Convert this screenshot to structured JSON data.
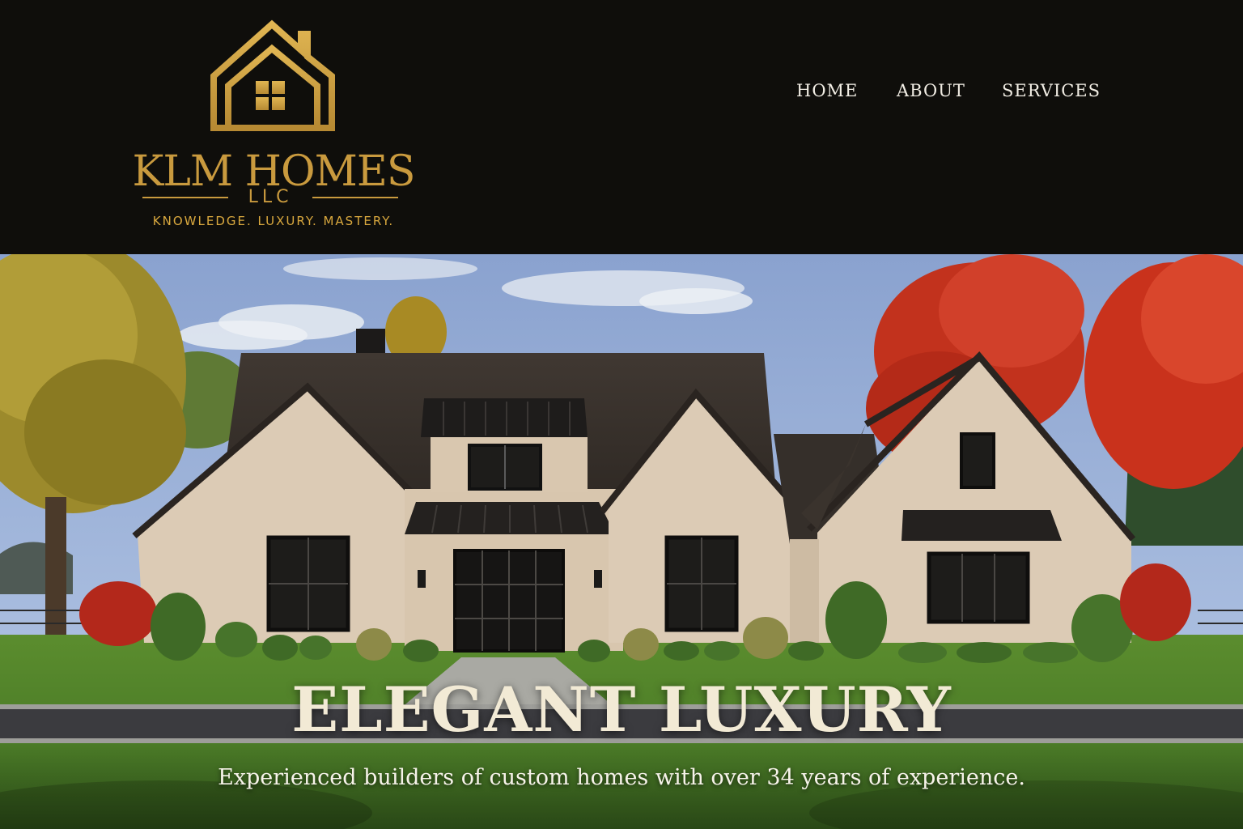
{
  "brand": {
    "name": "KLM HOMES",
    "suffix": "LLC",
    "tagline": "KNOWLEDGE.  LUXURY.  MASTERY.",
    "logo_icon": "house-icon",
    "color": "#c99a3e"
  },
  "nav": {
    "items": [
      {
        "label": "HOME"
      },
      {
        "label": "ABOUT"
      },
      {
        "label": "SERVICES"
      }
    ]
  },
  "hero": {
    "title": "ELEGANT LUXURY",
    "subtitle": "Experienced builders of custom homes with over 34 years of experience."
  },
  "colors": {
    "header_bg": "#0f0e0b",
    "text_light": "#f1ede4",
    "gold": "#c99a3e"
  }
}
